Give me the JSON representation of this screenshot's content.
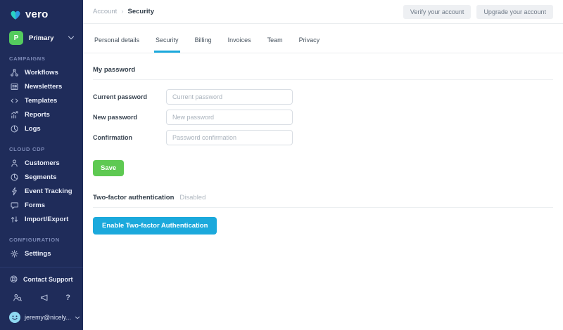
{
  "app": {
    "logo_text": "vero"
  },
  "workspace": {
    "initial": "P",
    "name": "Primary"
  },
  "sidebar": {
    "sections": [
      {
        "label": "CAMPAIGNS",
        "items": [
          {
            "icon": "workflows-icon",
            "label": "Workflows"
          },
          {
            "icon": "newsletters-icon",
            "label": "Newsletters"
          },
          {
            "icon": "templates-icon",
            "label": "Templates"
          },
          {
            "icon": "reports-icon",
            "label": "Reports"
          },
          {
            "icon": "logs-icon",
            "label": "Logs"
          }
        ]
      },
      {
        "label": "CLOUD CDP",
        "items": [
          {
            "icon": "customers-icon",
            "label": "Customers"
          },
          {
            "icon": "segments-icon",
            "label": "Segments"
          },
          {
            "icon": "event-tracking-icon",
            "label": "Event Tracking"
          },
          {
            "icon": "forms-icon",
            "label": "Forms"
          },
          {
            "icon": "import-export-icon",
            "label": "Import/Export"
          }
        ]
      },
      {
        "label": "CONFIGURATION",
        "items": [
          {
            "icon": "settings-icon",
            "label": "Settings"
          }
        ]
      }
    ],
    "footer": {
      "support_label": "Contact Support",
      "help_glyph": "?",
      "user_email": "jeremy@nicely..."
    }
  },
  "header": {
    "breadcrumb": {
      "parent": "Account",
      "separator": "›",
      "current": "Security"
    },
    "actions": [
      {
        "label": "Verify your account"
      },
      {
        "label": "Upgrade your account"
      }
    ]
  },
  "tabs": [
    {
      "label": "Personal details",
      "active": false
    },
    {
      "label": "Security",
      "active": true
    },
    {
      "label": "Billing",
      "active": false
    },
    {
      "label": "Invoices",
      "active": false
    },
    {
      "label": "Team",
      "active": false
    },
    {
      "label": "Privacy",
      "active": false
    }
  ],
  "content": {
    "password_section": {
      "title": "My password",
      "fields": [
        {
          "label": "Current password",
          "placeholder": "Current password",
          "value": ""
        },
        {
          "label": "New password",
          "placeholder": "New password",
          "value": ""
        },
        {
          "label": "Confirmation",
          "placeholder": "Password confirmation",
          "value": ""
        }
      ],
      "save_label": "Save"
    },
    "two_factor_section": {
      "title": "Two-factor authentication",
      "status": "Disabled",
      "enable_label": "Enable Two-factor Authentication"
    }
  },
  "colors": {
    "sidebar_bg": "#1F2C5A",
    "accent_blue": "#1BA9DC",
    "save_green": "#5EC952",
    "workspace_green": "#54CB5E",
    "logo_teal": "#2AD3C3",
    "logo_blue": "#2D9BE2"
  }
}
